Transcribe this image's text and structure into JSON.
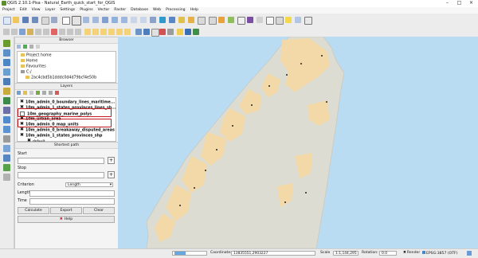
{
  "window": {
    "title": "QGIS 2.10.1-Pisa - Natural_Earth_quick_start_for_QGIS"
  },
  "menu": [
    "Project",
    "Edit",
    "View",
    "Layer",
    "Settings",
    "Plugins",
    "Vector",
    "Raster",
    "Database",
    "Web",
    "Processing",
    "Help"
  ],
  "browser": {
    "title": "Browser",
    "items": [
      "Project home",
      "Home",
      "Favourites",
      "C:/",
      "2ac4cbd5b1dddc0d4d79bcf4e50b"
    ]
  },
  "layers": {
    "title": "Layers",
    "items": [
      "10m_admin_0_boundary_lines_maritime...",
      "10m_admin_1_states_provinces_lines_sh...",
      "10m_geography_marine_polys",
      "10m_urban_area",
      "10m_admin_0_map_units",
      "10m_admin_0_breakaway_disputed_areas",
      "10m_admin_1_states_provinces_shp",
      "default"
    ]
  },
  "shortest_path": {
    "title": "Shortest path",
    "start_label": "Start",
    "stop_label": "Stop",
    "criterion_label": "Criterion",
    "criterion_value": "Length",
    "length_label": "Length",
    "time_label": "Time",
    "calculate": "Calculate",
    "export": "Export",
    "clear": "Clear",
    "help": "Help"
  },
  "status": {
    "coordinate_label": "Coordinate:",
    "coordinate_value": "13835551,2903227",
    "scale_label": "Scale",
    "scale_value": "1:1,144,295",
    "rotation_label": "Rotation:",
    "rotation_value": "0.0",
    "render_label": "Render",
    "crs": "EPSG:3857 (OTF)"
  },
  "colors": {
    "water": "#b9dcf2",
    "land": "#dcdcd2",
    "urban": "#f6d9a4",
    "accent_red": "#c0161e"
  }
}
